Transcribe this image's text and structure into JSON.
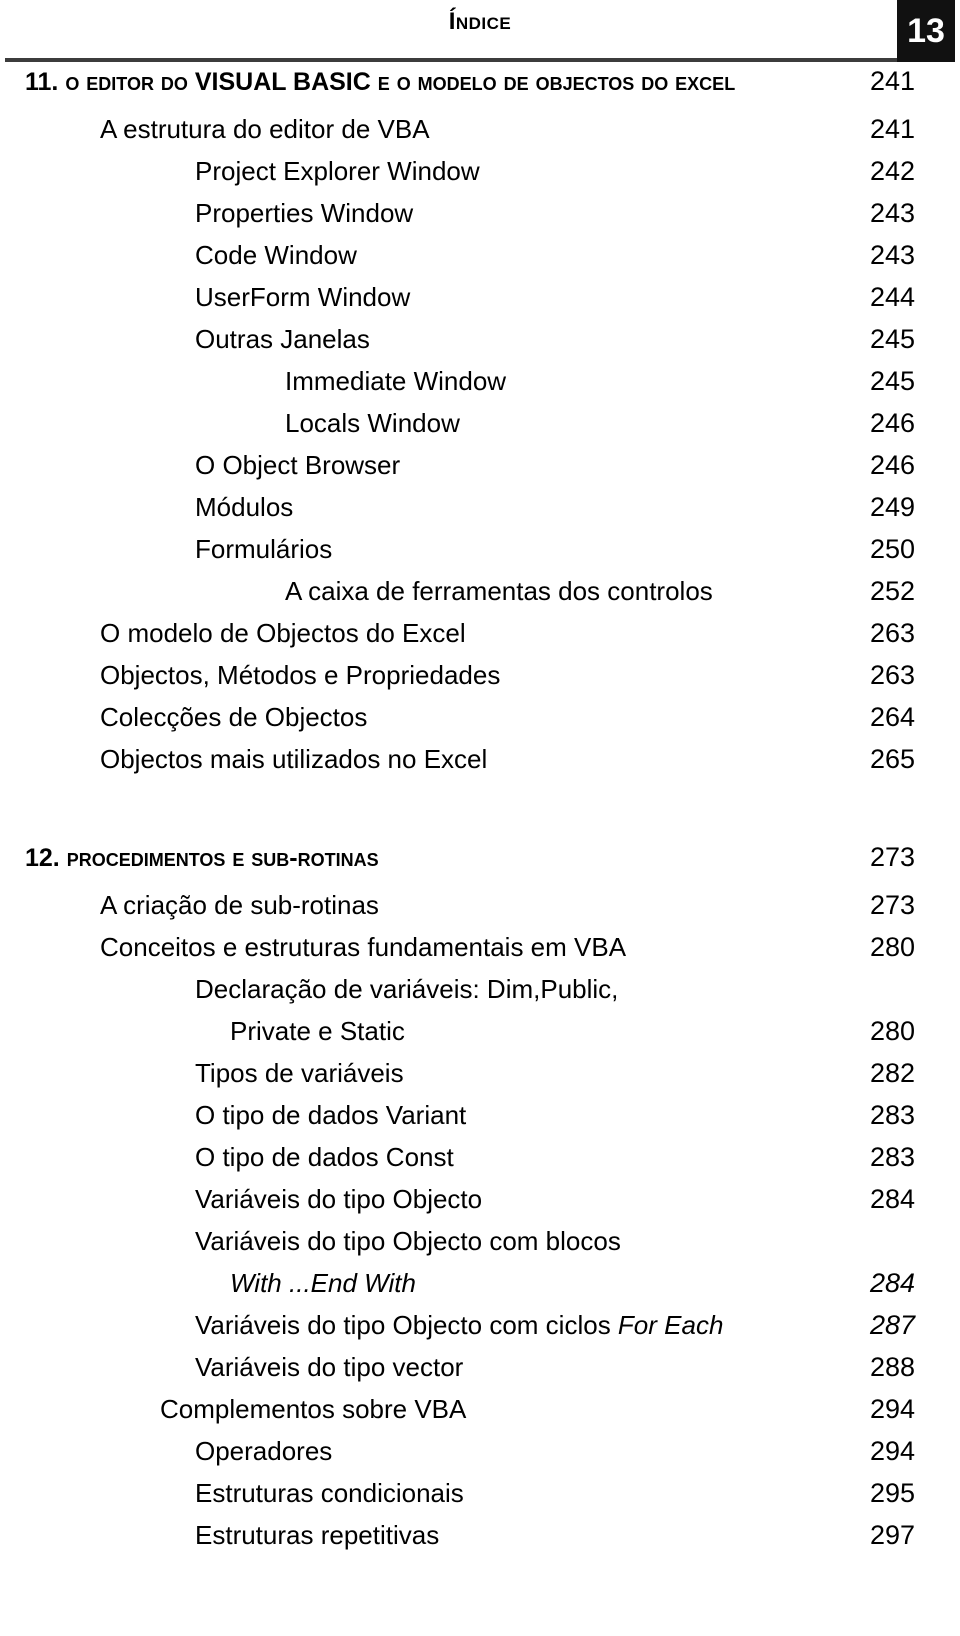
{
  "header": {
    "title": "ÍNDICE",
    "folio": "13"
  },
  "chapters": [
    {
      "number": "11.",
      "title_parts": [
        {
          "text": "O ",
          "style": "smallcaps"
        },
        {
          "text": "EDITOR DO ",
          "style": "smallcaps"
        },
        {
          "text": "VISUAL BASIC",
          "style": "caps"
        },
        {
          "text": " E O ",
          "style": "smallcaps"
        },
        {
          "text": "MODELO DE ",
          "style": "smallcaps"
        },
        {
          "text": "OBJECTOS DO ",
          "style": "smallcaps"
        },
        {
          "text": "EXCEL",
          "style": "smallcaps"
        }
      ],
      "title_plain": "O EDITOR DO VISUAL BASIC E O MODELO DE OBJECTOS DO EXCEL",
      "folio": "241",
      "entries": [
        {
          "label": "A estrutura do editor de VBA",
          "folio": "241",
          "level": 1,
          "italic": false
        },
        {
          "label": "Project Explorer Window",
          "folio": "242",
          "level": 2,
          "italic": false
        },
        {
          "label": "Properties Window",
          "folio": "243",
          "level": 2,
          "italic": false
        },
        {
          "label": "Code Window",
          "folio": "243",
          "level": 2,
          "italic": false
        },
        {
          "label": "UserForm Window",
          "folio": "244",
          "level": 2,
          "italic": false
        },
        {
          "label": "Outras Janelas",
          "folio": "245",
          "level": 2,
          "italic": false
        },
        {
          "label": "Immediate Window",
          "folio": "245",
          "level": 3,
          "italic": false
        },
        {
          "label": "Locals Window",
          "folio": "246",
          "level": 3,
          "italic": false
        },
        {
          "label": "O Object Browser",
          "folio": "246",
          "level": 2,
          "italic": false
        },
        {
          "label": "Módulos",
          "folio": "249",
          "level": 2,
          "italic": false
        },
        {
          "label": "Formulários",
          "folio": "250",
          "level": 2,
          "italic": false
        },
        {
          "label": "A caixa de ferramentas dos controlos",
          "folio": "252",
          "level": 3,
          "italic": false
        },
        {
          "label": "O modelo de Objectos do Excel",
          "folio": "263",
          "level": 1,
          "italic": false
        },
        {
          "label": "Objectos, Métodos e Propriedades",
          "folio": "263",
          "level": 1,
          "italic": false
        },
        {
          "label": "Colecções de Objectos",
          "folio": "264",
          "level": 1,
          "italic": false
        },
        {
          "label": "Objectos mais utilizados no Excel",
          "folio": "265",
          "level": 1,
          "italic": false
        }
      ]
    },
    {
      "number": "12.",
      "title_parts": [
        {
          "text": "PROCEDIMENTOS E SUB-ROTINAS",
          "style": "smallcaps"
        }
      ],
      "title_plain": "PROCEDIMENTOS E SUB-ROTINAS",
      "folio": "273",
      "entries": [
        {
          "label": "A criação de sub-rotinas",
          "folio": "273",
          "level": 1,
          "italic": false
        },
        {
          "label": "Conceitos e estruturas fundamentais em VBA",
          "folio": "280",
          "level": 1,
          "italic": false
        },
        {
          "label": "Declaração de variáveis: Dim,Public,",
          "folio": "",
          "level": 2,
          "italic": false
        },
        {
          "label": "Private e Static",
          "folio": "280",
          "level": 4,
          "italic": false
        },
        {
          "label": "Tipos de variáveis",
          "folio": "282",
          "level": 2,
          "italic": false
        },
        {
          "label": "O tipo de dados Variant",
          "folio": "283",
          "level": 2,
          "italic": false
        },
        {
          "label": "O tipo de dados Const",
          "folio": "283",
          "level": 2,
          "italic": false
        },
        {
          "label": "Variáveis do tipo Objecto",
          "folio": "284",
          "level": 2,
          "italic": false
        },
        {
          "label": "Variáveis do tipo Objecto com blocos",
          "folio": "",
          "level": 2,
          "italic": false
        },
        {
          "label": "With ...End With",
          "folio": "284",
          "level": 4,
          "italic": true
        },
        {
          "label_pre": "Variáveis do tipo Objecto com ciclos ",
          "label_it": "For Each",
          "label": "Variáveis do tipo Objecto com ciclos For Each",
          "folio": "287",
          "level": 2,
          "italic": false,
          "folio_italic": true
        },
        {
          "label": "Variáveis do tipo vector",
          "folio": "288",
          "level": 2,
          "italic": false
        },
        {
          "label": "Complementos sobre VBA",
          "folio": "294",
          "level": 5,
          "italic": false
        },
        {
          "label": "Operadores",
          "folio": "294",
          "level": 2,
          "italic": false
        },
        {
          "label": "Estruturas condicionais",
          "folio": "295",
          "level": 2,
          "italic": false
        },
        {
          "label": "Estruturas repetitivas",
          "folio": "297",
          "level": 2,
          "italic": false
        }
      ]
    }
  ]
}
